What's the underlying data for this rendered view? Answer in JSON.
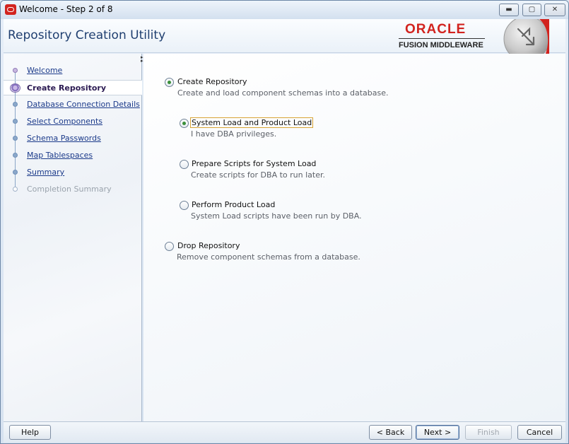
{
  "window": {
    "title": "Welcome - Step 2 of 8",
    "controls": {
      "minimize": "▬",
      "maximize": "▢",
      "close": "✕"
    }
  },
  "header": {
    "title": "Repository Creation Utility",
    "logo_top": "ORACLE",
    "logo_bottom": "FUSION MIDDLEWARE",
    "brand_color": "#d2231e"
  },
  "steps": [
    {
      "label": "Welcome",
      "state": "visited"
    },
    {
      "label": "Create Repository",
      "state": "current"
    },
    {
      "label": "Database Connection Details",
      "state": "link"
    },
    {
      "label": "Select Components",
      "state": "link"
    },
    {
      "label": "Schema Passwords",
      "state": "link"
    },
    {
      "label": "Map Tablespaces",
      "state": "link"
    },
    {
      "label": "Summary",
      "state": "link"
    },
    {
      "label": "Completion Summary",
      "state": "disabled"
    }
  ],
  "options": {
    "create": {
      "label": "Create Repository",
      "desc": "Create and load component schemas into a database.",
      "selected": true
    },
    "system_product": {
      "label": "System Load and Product Load",
      "desc": "I have DBA privileges.",
      "selected": true
    },
    "prepare": {
      "label": "Prepare Scripts for System Load",
      "desc": "Create scripts for DBA to run later.",
      "selected": false
    },
    "product": {
      "label": "Perform Product Load",
      "desc": "System Load scripts have been run by DBA.",
      "selected": false
    },
    "drop": {
      "label": "Drop Repository",
      "desc": "Remove component schemas from a database.",
      "selected": false
    }
  },
  "buttons": {
    "help": "Help",
    "back": "< Back",
    "next": "Next >",
    "finish": "Finish",
    "cancel": "Cancel"
  }
}
